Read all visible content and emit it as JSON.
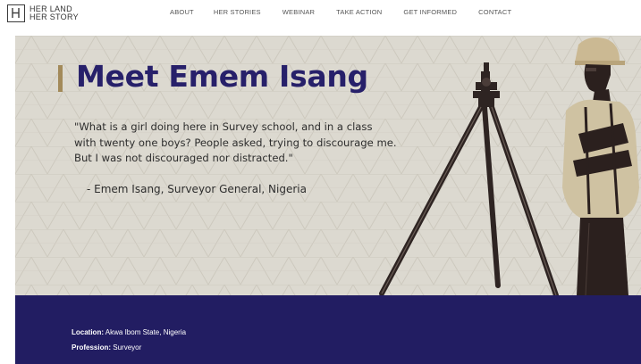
{
  "logo": {
    "line1": "HER LAND",
    "line2": "HER STORY"
  },
  "nav": {
    "items": [
      {
        "label": "ABOUT"
      },
      {
        "label": "HER STORIES"
      },
      {
        "label": "WEBINAR"
      },
      {
        "label": "TAKE ACTION"
      },
      {
        "label": "GET INFORMED"
      },
      {
        "label": "CONTACT"
      }
    ]
  },
  "hero": {
    "title": "Meet Emem Isang",
    "quote_lines": [
      "\"What is a girl doing here in Survey school, and in a class",
      "with twenty one boys? People asked, trying to discourage me.",
      "But I was not discouraged nor distracted.\""
    ],
    "attribution": "- Emem Isang, Surveyor General, Nigeria"
  },
  "profile": {
    "location_label": "Location:",
    "location_value": "Akwa Ibom State, Nigeria",
    "profession_label": "Profession:",
    "profession_value": "Surveyor"
  },
  "colors": {
    "brand_navy": "#27206a",
    "band_navy": "#221d62",
    "accent_gold": "#a38a5a",
    "hero_bg": "#dcd9d0"
  }
}
